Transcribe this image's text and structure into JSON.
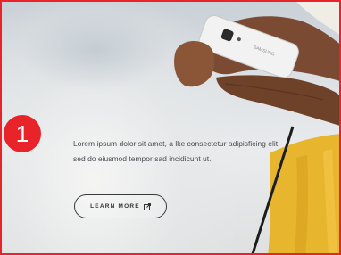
{
  "hero": {
    "description": "Lorem ipsum dolor sit amet, a lke consectetur adipisficing elit, sed do eiusmod tempor sad incidicunt ut.",
    "cta_label": "LEARN MORE",
    "cta_icon": "external-link-icon",
    "phone_brand": "SAMSUNG"
  },
  "callout": {
    "number": "1"
  },
  "colors": {
    "accent_red": "#e8232a",
    "skirt_yellow": "#e8b62e",
    "text_gray": "#4a4d52"
  }
}
